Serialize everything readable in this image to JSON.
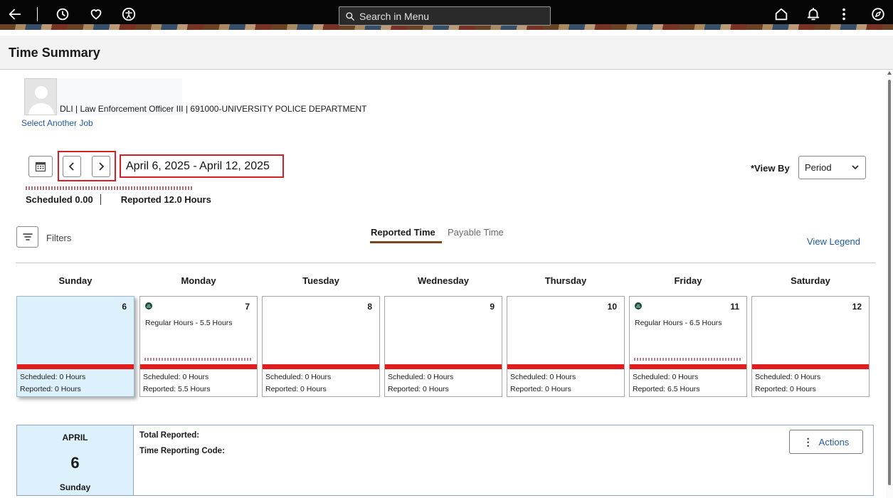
{
  "topbar": {
    "search_placeholder": "Search in Menu",
    "icons": [
      "back-arrow-icon",
      "history-clock-icon",
      "favorites-heart-icon",
      "accessibility-icon",
      "home-icon",
      "notifications-bell-icon",
      "more-options-icon",
      "navigator-compass-icon"
    ]
  },
  "page": {
    "title": "Time Summary"
  },
  "job": {
    "description": "DLI | Law Enforcement Officer III | 691000-UNIVERSITY POLICE DEPARTMENT",
    "select_another": "Select Another Job"
  },
  "period": {
    "range": "April 6, 2025 - April 12, 2025",
    "scheduled_label": "Scheduled",
    "scheduled_value": "0.00",
    "reported_label": "Reported",
    "reported_value": "12.0 Hours"
  },
  "view_by": {
    "label": "*View By",
    "selected": "Period"
  },
  "filters": {
    "label": "Filters"
  },
  "tabs": {
    "reported": "Reported Time",
    "payable": "Payable Time"
  },
  "legend_link": "View Legend",
  "days": [
    {
      "name": "Sunday",
      "num": "6",
      "entry": "",
      "scheduled": "Scheduled: 0 Hours",
      "reported": "Reported: 0 Hours"
    },
    {
      "name": "Monday",
      "num": "7",
      "entry": "Regular Hours - 5.5 Hours",
      "scheduled": "Scheduled: 0 Hours",
      "reported": "Reported: 5.5 Hours"
    },
    {
      "name": "Tuesday",
      "num": "8",
      "entry": "",
      "scheduled": "Scheduled: 0 Hours",
      "reported": "Reported: 0 Hours"
    },
    {
      "name": "Wednesday",
      "num": "9",
      "entry": "",
      "scheduled": "Scheduled: 0 Hours",
      "reported": "Reported: 0 Hours"
    },
    {
      "name": "Thursday",
      "num": "10",
      "entry": "",
      "scheduled": "Scheduled: 0 Hours",
      "reported": "Reported: 0 Hours"
    },
    {
      "name": "Friday",
      "num": "11",
      "entry": "Regular Hours - 6.5 Hours",
      "scheduled": "Scheduled: 0 Hours",
      "reported": "Reported: 6.5 Hours"
    },
    {
      "name": "Saturday",
      "num": "12",
      "entry": "",
      "scheduled": "Scheduled: 0 Hours",
      "reported": "Reported: 0 Hours"
    }
  ],
  "detail": {
    "month": "APRIL",
    "day": "6",
    "weekday": "Sunday",
    "total_reported_label": "Total Reported:",
    "trc_label": "Time Reporting Code:",
    "actions_label": "Actions"
  },
  "colors": {
    "accent_link": "#1f5a9e",
    "highlight_red": "#d61f26",
    "status_bar": "#e11d1d",
    "selected_bg": "#dcf1fb"
  }
}
